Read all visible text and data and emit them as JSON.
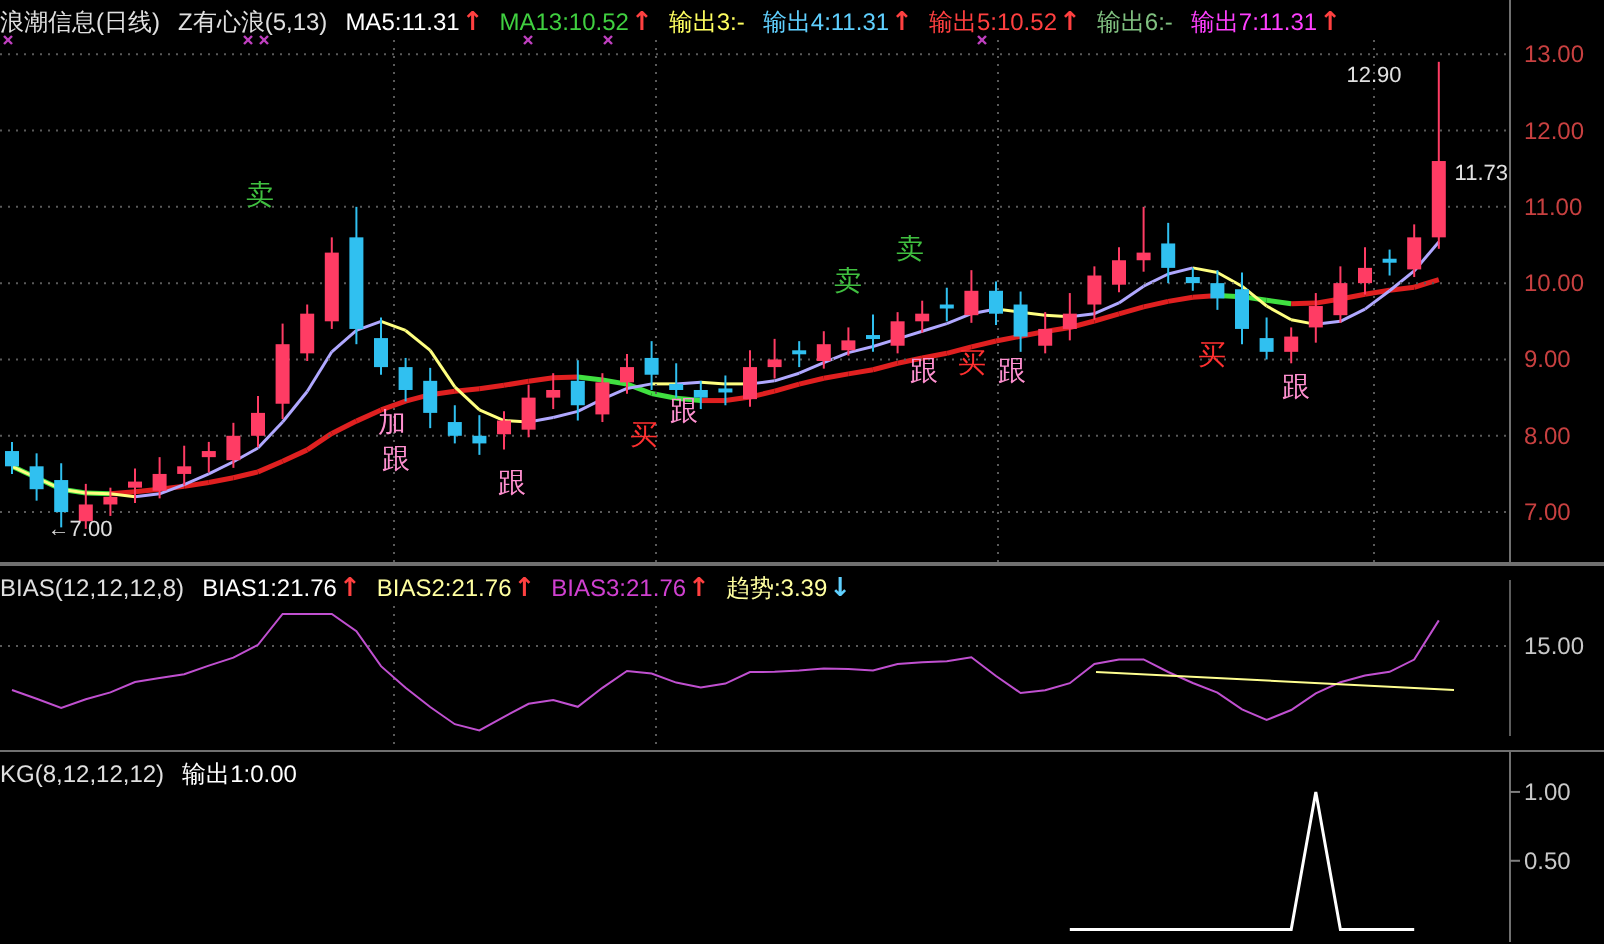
{
  "main_panel": {
    "header": [
      {
        "kind": "value",
        "text": "浪潮信息(日线)",
        "color": "#e0e0e0"
      },
      {
        "kind": "value",
        "text": "Z有心浪(5,13)",
        "color": "#e0e0e0"
      },
      {
        "kind": "value",
        "text": "MA5:11.31",
        "color": "#ffffff"
      },
      {
        "kind": "arrow",
        "text": "↑",
        "color": "#ff4040"
      },
      {
        "kind": "value",
        "text": "MA13:10.52",
        "color": "#40d040"
      },
      {
        "kind": "arrow",
        "text": "↑",
        "color": "#ff4040"
      },
      {
        "kind": "value",
        "text": "输出3:-",
        "color": "#ffff60"
      },
      {
        "kind": "value",
        "text": "输出4:11.31",
        "color": "#60d0ff"
      },
      {
        "kind": "arrow",
        "text": "↑",
        "color": "#ff4040"
      },
      {
        "kind": "value",
        "text": "输出5:10.52",
        "color": "#ff4040"
      },
      {
        "kind": "arrow",
        "text": "↑",
        "color": "#ff4040"
      },
      {
        "kind": "value",
        "text": "输出6:-",
        "color": "#80c080"
      },
      {
        "kind": "value",
        "text": "输出7:11.31",
        "color": "#ff40ff"
      },
      {
        "kind": "arrow",
        "text": "↑",
        "color": "#ff4040"
      }
    ],
    "chart_data": {
      "type": "candlestick",
      "ylim": [
        6.32,
        13.71
      ],
      "categories": [
        null,
        null,
        null,
        null,
        null,
        null,
        null,
        null,
        null,
        null,
        null,
        null,
        null,
        null,
        null,
        null,
        null,
        null,
        null,
        null,
        null,
        null,
        null,
        null,
        null,
        null,
        null,
        null,
        null,
        null,
        null,
        null,
        null,
        null,
        null,
        null,
        null,
        null,
        null,
        null,
        null,
        null,
        null,
        null,
        null,
        null,
        null,
        null,
        null,
        null,
        null,
        null,
        null,
        null,
        null,
        null,
        null,
        null,
        null
      ],
      "yticks": [
        {
          "value": 13,
          "label": "13.00"
        },
        {
          "value": 12,
          "label": "12.00"
        },
        {
          "value": 11,
          "label": "11.00"
        },
        {
          "value": 10,
          "label": "10.00"
        },
        {
          "value": 9,
          "label": "9.00"
        },
        {
          "value": 8,
          "label": "8.00"
        },
        {
          "value": 7,
          "label": "7.00"
        }
      ],
      "ohlc": [
        [
          7.8,
          7.92,
          7.5,
          7.6
        ],
        [
          7.6,
          7.77,
          7.15,
          7.3
        ],
        [
          7.42,
          7.64,
          6.8,
          7.0
        ],
        [
          6.88,
          7.37,
          6.78,
          7.1
        ],
        [
          7.1,
          7.32,
          6.95,
          7.2
        ],
        [
          7.32,
          7.57,
          7.12,
          7.4
        ],
        [
          7.28,
          7.72,
          7.18,
          7.5
        ],
        [
          7.5,
          7.87,
          7.35,
          7.6
        ],
        [
          7.72,
          7.92,
          7.52,
          7.8
        ],
        [
          7.68,
          8.17,
          7.58,
          8.0
        ],
        [
          8.0,
          8.52,
          7.85,
          8.3
        ],
        [
          8.42,
          9.47,
          8.22,
          9.2
        ],
        [
          9.08,
          9.72,
          8.98,
          9.6
        ],
        [
          9.5,
          10.6,
          9.4,
          10.4
        ],
        [
          10.6,
          11.0,
          9.2,
          9.4
        ],
        [
          9.28,
          9.55,
          8.8,
          8.9
        ],
        [
          8.9,
          9.02,
          8.45,
          8.6
        ],
        [
          8.72,
          8.89,
          8.1,
          8.3
        ],
        [
          8.18,
          8.4,
          7.9,
          8.0
        ],
        [
          8.0,
          8.27,
          7.75,
          7.9
        ],
        [
          8.02,
          8.32,
          7.82,
          8.2
        ],
        [
          8.08,
          8.67,
          7.98,
          8.5
        ],
        [
          8.5,
          8.82,
          8.35,
          8.6
        ],
        [
          8.72,
          8.99,
          8.2,
          8.4
        ],
        [
          8.28,
          8.82,
          8.18,
          8.7
        ],
        [
          8.7,
          9.07,
          8.55,
          8.9
        ],
        [
          9.02,
          9.24,
          8.6,
          8.8
        ],
        [
          8.68,
          8.95,
          8.5,
          8.6
        ],
        [
          8.6,
          8.72,
          8.35,
          8.5
        ],
        [
          8.62,
          8.79,
          8.4,
          8.6
        ],
        [
          8.48,
          9.12,
          8.38,
          8.9
        ],
        [
          8.9,
          9.27,
          8.75,
          9.0
        ],
        [
          9.12,
          9.24,
          8.9,
          9.1
        ],
        [
          8.98,
          9.37,
          8.88,
          9.2
        ],
        [
          9.12,
          9.42,
          9.05,
          9.25
        ],
        [
          9.32,
          9.59,
          9.1,
          9.3
        ],
        [
          9.18,
          9.62,
          9.08,
          9.5
        ],
        [
          9.5,
          9.77,
          9.35,
          9.6
        ],
        [
          9.72,
          9.94,
          9.5,
          9.7
        ],
        [
          9.58,
          10.17,
          9.48,
          9.9
        ],
        [
          9.9,
          10.02,
          9.45,
          9.6
        ],
        [
          9.72,
          9.89,
          9.1,
          9.3
        ],
        [
          9.18,
          9.62,
          9.08,
          9.4
        ],
        [
          9.4,
          9.87,
          9.25,
          9.6
        ],
        [
          9.72,
          10.22,
          9.52,
          10.1
        ],
        [
          9.98,
          10.47,
          9.88,
          10.3
        ],
        [
          10.3,
          11.0,
          10.15,
          10.4
        ],
        [
          10.52,
          10.79,
          10.0,
          10.2
        ],
        [
          10.08,
          10.2,
          9.9,
          10.0
        ],
        [
          10.0,
          10.17,
          9.65,
          9.8
        ],
        [
          9.92,
          10.14,
          9.2,
          9.4
        ],
        [
          9.28,
          9.55,
          9.0,
          9.1
        ],
        [
          9.1,
          9.42,
          8.95,
          9.3
        ],
        [
          9.42,
          9.87,
          9.22,
          9.7
        ],
        [
          9.58,
          10.22,
          9.48,
          10.0
        ],
        [
          10.0,
          10.47,
          9.85,
          10.2
        ],
        [
          10.32,
          10.44,
          10.1,
          10.3
        ],
        [
          10.18,
          10.77,
          10.08,
          10.6
        ],
        [
          10.6,
          12.9,
          10.45,
          11.6
        ]
      ],
      "grid": true
    },
    "signals": [
      {
        "text": "卖",
        "kind": "sell"
      },
      {
        "text": "加",
        "kind": "add"
      },
      {
        "text": "跟",
        "kind": "follow"
      },
      {
        "text": "跟",
        "kind": "follow"
      },
      {
        "text": "买",
        "kind": "buy"
      },
      {
        "text": "跟",
        "kind": "follow"
      },
      {
        "text": "卖",
        "kind": "sell"
      },
      {
        "text": "卖",
        "kind": "sell"
      },
      {
        "text": "跟",
        "kind": "follow"
      },
      {
        "text": "买",
        "kind": "buy"
      },
      {
        "text": "跟",
        "kind": "follow"
      },
      {
        "text": "买",
        "kind": "buy"
      },
      {
        "text": "跟",
        "kind": "follow"
      }
    ],
    "price_labels": [
      {
        "text": "12.90",
        "kind": "high"
      },
      {
        "text": "11.73",
        "kind": "last"
      },
      {
        "text": "←7.00",
        "kind": "low"
      }
    ]
  },
  "bias_panel": {
    "header": [
      {
        "kind": "value",
        "text": "BIAS(12,12,12,8)",
        "color": "#e0e0e0"
      },
      {
        "kind": "value",
        "text": "BIAS1:21.76",
        "color": "#ffffff"
      },
      {
        "kind": "arrow",
        "text": "↑",
        "color": "#ff4040"
      },
      {
        "kind": "value",
        "text": "BIAS2:21.76",
        "color": "#ffffa0"
      },
      {
        "kind": "arrow",
        "text": "↑",
        "color": "#ff4040"
      },
      {
        "kind": "value",
        "text": "BIAS3:21.76",
        "color": "#d040d0"
      },
      {
        "kind": "arrow",
        "text": "↑",
        "color": "#ff4040"
      },
      {
        "kind": "value",
        "text": "趋势:3.39",
        "color": "#ffffa0"
      },
      {
        "kind": "arrow",
        "text": "↓",
        "color": "#60d0ff"
      }
    ],
    "axis": [
      "15.00"
    ]
  },
  "kg_panel": {
    "header": [
      {
        "kind": "value",
        "text": "KG(8,12,12,12)",
        "color": "#e0e0e0"
      },
      {
        "kind": "value",
        "text": "输出1:0.00",
        "color": "#ffffff"
      }
    ],
    "chart_data": {
      "type": "line",
      "ylim": [
        -0.09,
        1.29
      ],
      "categories": [
        null,
        null,
        null,
        null,
        null,
        null,
        null,
        null,
        null,
        null,
        null,
        null,
        null,
        null,
        null,
        null,
        null,
        null,
        null,
        null,
        null,
        null,
        null,
        null,
        null,
        null,
        null,
        null,
        null,
        null,
        null,
        null,
        null,
        null,
        null,
        null,
        null,
        null,
        null,
        null,
        null,
        null,
        null,
        null,
        null,
        null,
        null,
        null,
        null,
        null,
        null,
        null,
        null,
        null,
        null,
        null,
        null,
        null,
        null
      ],
      "yticks": [
        {
          "value": 0.5,
          "label": "0.50"
        },
        {
          "value": 1,
          "label": "1.00"
        }
      ],
      "series": [
        {
          "color": "#ffffff",
          "values": [
            null,
            null,
            null,
            null,
            null,
            null,
            null,
            null,
            null,
            null,
            null,
            null,
            null,
            null,
            null,
            null,
            null,
            null,
            null,
            null,
            null,
            null,
            null,
            null,
            null,
            null,
            null,
            null,
            null,
            null,
            null,
            null,
            null,
            null,
            null,
            null,
            null,
            null,
            null,
            null,
            null,
            null,
            null,
            0,
            0,
            0,
            0,
            0,
            0,
            0,
            0,
            0,
            0,
            1,
            0,
            0,
            0,
            0,
            null
          ]
        }
      ]
    }
  }
}
